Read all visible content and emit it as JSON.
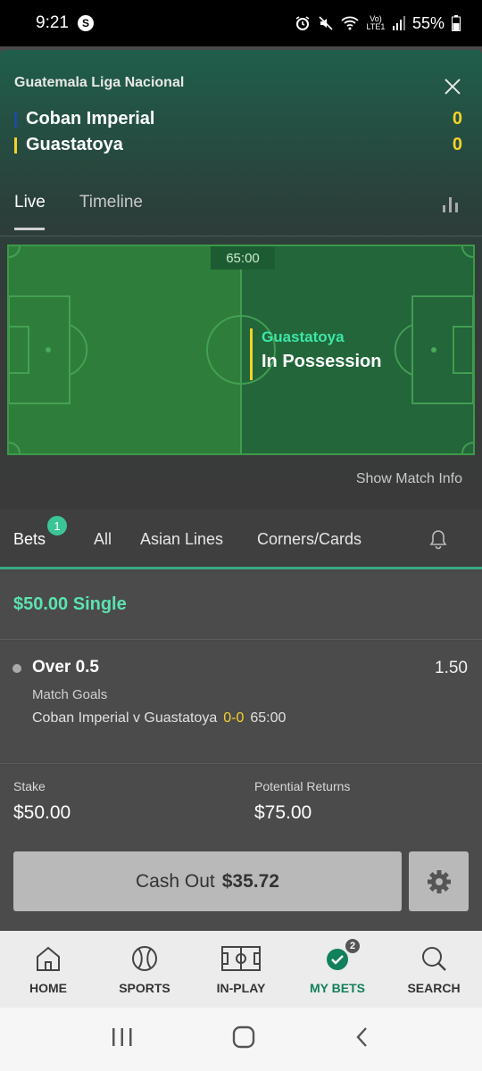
{
  "status_bar": {
    "time": "9:21",
    "app_badge": "S",
    "network_label": "Vo) LTE1",
    "battery": "55%"
  },
  "match": {
    "league": "Guatemala Liga Nacional",
    "team1": {
      "name": "Coban Imperial",
      "score": "0",
      "color": "#1f4aa0"
    },
    "team2": {
      "name": "Guastatoya",
      "score": "0",
      "color": "#f5d22a"
    },
    "tabs": [
      "Live",
      "Timeline"
    ],
    "clock": "65:00",
    "possession_team": "Guastatoya",
    "possession_label": "In Possession",
    "show_info": "Show Match Info"
  },
  "bet_tabs": {
    "items": [
      "Bets",
      "All",
      "Asian Lines",
      "Corners/Cards"
    ],
    "bets_count": "1"
  },
  "bet": {
    "title": "$50.00 Single",
    "selection": "Over 0.5",
    "odds": "1.50",
    "market": "Match Goals",
    "event": "Coban Imperial v Guastatoya",
    "event_score": "0-0",
    "event_time": "65:00",
    "stake_label": "Stake",
    "stake_value": "$50.00",
    "returns_label": "Potential Returns",
    "returns_value": "$75.00",
    "cashout_label": "Cash Out",
    "cashout_value": "$35.72"
  },
  "bottom_nav": {
    "items": [
      "HOME",
      "SPORTS",
      "IN-PLAY",
      "MY BETS",
      "SEARCH"
    ],
    "my_bets_count": "2",
    "active": "MY BETS"
  },
  "colors": {
    "accent": "#37a886",
    "score_yellow": "#f5d22a",
    "possession_green": "#3de6a6"
  }
}
